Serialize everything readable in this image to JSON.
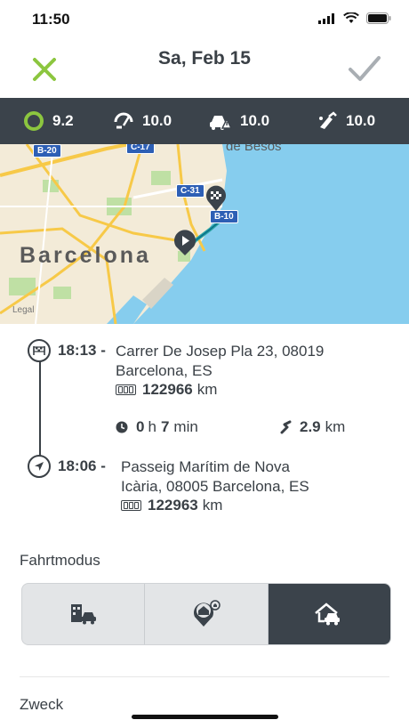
{
  "status": {
    "time": "11:50"
  },
  "nav": {
    "title": "Sa, Feb 15"
  },
  "scores": [
    {
      "icon": "score-ring-icon",
      "value": "9.2"
    },
    {
      "icon": "speed-gauge-icon",
      "value": "10.0"
    },
    {
      "icon": "car-warning-icon",
      "value": "10.0"
    },
    {
      "icon": "fuel-pump-icon",
      "value": "10.0"
    }
  ],
  "map": {
    "city_label": "Barcelona",
    "district_label": "de Besòs",
    "legal_label": "Legal",
    "roads": [
      "B-20",
      "C-17",
      "C-31",
      "B-10"
    ]
  },
  "trip": {
    "end": {
      "time": "18:13 -",
      "address_line1": "Carrer De Josep Pla 23, 08019",
      "address_line2": "Barcelona, ES",
      "odometer": "122966",
      "odometer_unit": "km"
    },
    "duration": {
      "hours": "0",
      "h_unit": "h",
      "minutes": "7",
      "min_unit": "min"
    },
    "distance": {
      "value": "2.9",
      "unit": "km"
    },
    "start": {
      "time": "18:06 -",
      "address_line1": "Passeig Marítim de Nova",
      "address_line2": "Icària, 08005 Barcelona, ES",
      "odometer": "122963",
      "odometer_unit": "km"
    }
  },
  "drive_mode": {
    "label": "Fahrtmodus",
    "options": [
      {
        "name": "business",
        "icon": "building-car-icon",
        "active": false
      },
      {
        "name": "commute",
        "icon": "home-location-icon",
        "active": false
      },
      {
        "name": "private",
        "icon": "home-car-icon",
        "active": true
      }
    ]
  },
  "purpose": {
    "label": "Zweck"
  },
  "colors": {
    "accent_green": "#8cc63f",
    "dark_bar": "#3b434b",
    "water": "#7fc8ea"
  }
}
